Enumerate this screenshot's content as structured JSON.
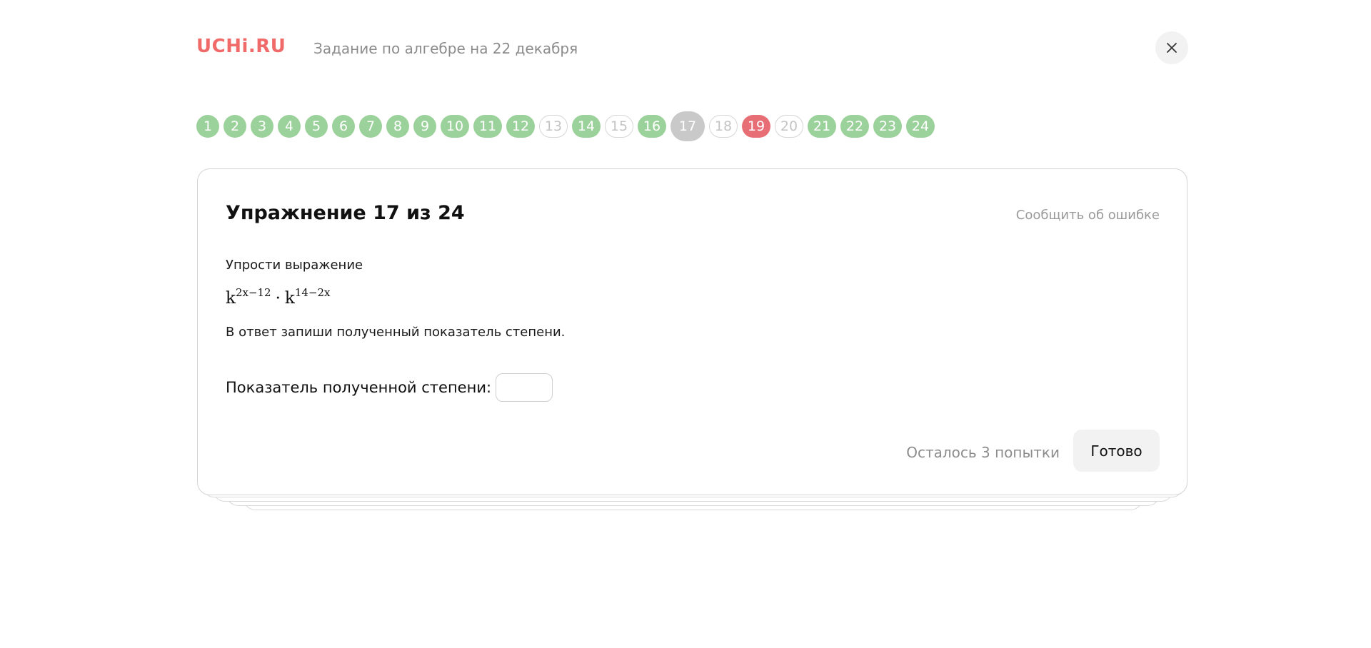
{
  "header": {
    "logo": "UCHi.RU",
    "assignment_title": "Задание по алгебре на 22 декабря"
  },
  "progress": [
    {
      "label": "1",
      "status": "done"
    },
    {
      "label": "2",
      "status": "done"
    },
    {
      "label": "3",
      "status": "done"
    },
    {
      "label": "4",
      "status": "done"
    },
    {
      "label": "5",
      "status": "done"
    },
    {
      "label": "6",
      "status": "done"
    },
    {
      "label": "7",
      "status": "done"
    },
    {
      "label": "8",
      "status": "done"
    },
    {
      "label": "9",
      "status": "done"
    },
    {
      "label": "10",
      "status": "done"
    },
    {
      "label": "11",
      "status": "done"
    },
    {
      "label": "12",
      "status": "done"
    },
    {
      "label": "13",
      "status": "empty"
    },
    {
      "label": "14",
      "status": "done"
    },
    {
      "label": "15",
      "status": "empty"
    },
    {
      "label": "16",
      "status": "done"
    },
    {
      "label": "17",
      "status": "current"
    },
    {
      "label": "18",
      "status": "empty"
    },
    {
      "label": "19",
      "status": "wrong"
    },
    {
      "label": "20",
      "status": "empty"
    },
    {
      "label": "21",
      "status": "done"
    },
    {
      "label": "22",
      "status": "done"
    },
    {
      "label": "23",
      "status": "done"
    },
    {
      "label": "24",
      "status": "done"
    }
  ],
  "exercise": {
    "title": "Упражнение 17 из 24",
    "report_link": "Сообщить об ошибке",
    "instruction": "Упрости выражение",
    "expression": {
      "base1": "k",
      "exp1": "2x−12",
      "operator": "·",
      "base2": "k",
      "exp2": "14−2x"
    },
    "answer_hint": "В ответ запиши полученный показатель степени.",
    "answer_label": "Показатель полученной степени:",
    "answer_value": "",
    "attempts_left": "Осталось 3 попытки",
    "done_label": "Готово"
  },
  "colors": {
    "brand": "#f06a6a",
    "done": "#9bd19a",
    "wrong": "#e86e76",
    "current": "#c9c9c9"
  }
}
